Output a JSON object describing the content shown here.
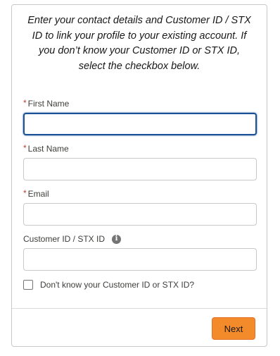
{
  "intro": {
    "text": "Enter your contact details and Customer ID / STX ID to link your profile to your existing account. If you don’t know your Customer ID or STX ID, select the checkbox below."
  },
  "form": {
    "first_name": {
      "required_marker": "*",
      "label": "First Name",
      "value": ""
    },
    "last_name": {
      "required_marker": "*",
      "label": "Last Name",
      "value": ""
    },
    "email": {
      "required_marker": "*",
      "label": "Email",
      "value": ""
    },
    "customer_id": {
      "label": "Customer ID / STX ID",
      "info_icon": "info-icon",
      "value": ""
    },
    "unknown_id_checkbox": {
      "label": "Don't know your Customer ID or STX ID?",
      "checked": false
    }
  },
  "footer": {
    "next_label": "Next"
  },
  "colors": {
    "required": "#c23934",
    "focus_border": "#1b5297",
    "button_bg": "#f38b2b",
    "border": "#c9c9c9"
  }
}
